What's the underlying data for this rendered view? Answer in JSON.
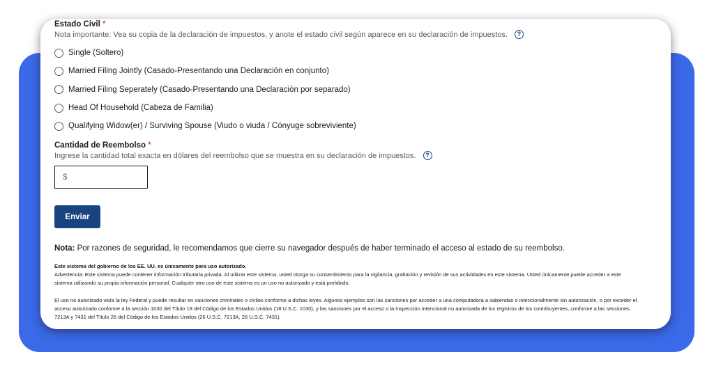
{
  "marital_status": {
    "label": "Estado Civil",
    "required_mark": "*",
    "hint": "Nota importante: Vea su copia de la declaración de impuestos, y anote el estado civil según aparece en su declaración de impuestos.",
    "help_icon": "?",
    "options": [
      "Single (Soltero)",
      "Married Filing Jointly (Casado-Presentando una Declaración en conjunto)",
      "Married Filing Seperately (Casado-Presentando una Declaración por separado)",
      "Head Of Household (Cabeza de Familia)",
      "Qualifying Widow(er) / Surviving Spouse (Viudo o viuda / Cónyuge sobreviviente)"
    ]
  },
  "refund": {
    "label": "Cantidad de Reembolso",
    "required_mark": "*",
    "hint": "Ingrese la cantidad total exacta en dólares del reembolso que se muestra en su declaración de impuestos.",
    "help_icon": "?",
    "currency_prefix": "$"
  },
  "submit_label": "Enviar",
  "note": {
    "prefix": "Nota:",
    "text": " Por razones de seguridad, le recomendamos que cierre su navegador después de haber terminado el acceso al estado de su reembolso."
  },
  "legal": {
    "title": "Este sistema del gobierno de los EE. UU. es únicamente para uso autorizado.",
    "warning": "Advertencia: Este sistema puede contener información tributaria privada. Al utilizar este sistema, usted otorga su consentimiento para la vigilancia, grabación y revisión de sus actividades en este sistema. Usted únicamente puede acceder a este sistema utilizando su propia información personal. Cualquier otro uso de este sistema es un uso no autorizado y está prohibido.",
    "penalties": "El uso no autorizado viola la ley Federal y puede resultar en sanciones criminales o civiles conforme a dichas leyes. Algunos ejemplos son las sanciones por acceder a una computadora a sabiendas o intencionalmente sin autorización, o por exceder el acceso autorizado conforme a la sección 1030 del Título 18 del Código de los Estados Unidos (18 U.S.C. 1030), y las sanciones por el acceso o la inspección intencional no autorizada de los registros de los contribuyentes, conforme a las secciones 7213A y 7431 del Título 26 del Código de los Estados Unidos (26 U.S.C. 7213A, 26 U.S.C. 7431)."
  },
  "colors": {
    "backdrop": "#3a6ae8",
    "primary_button": "#1a4480",
    "required": "#b50909"
  }
}
